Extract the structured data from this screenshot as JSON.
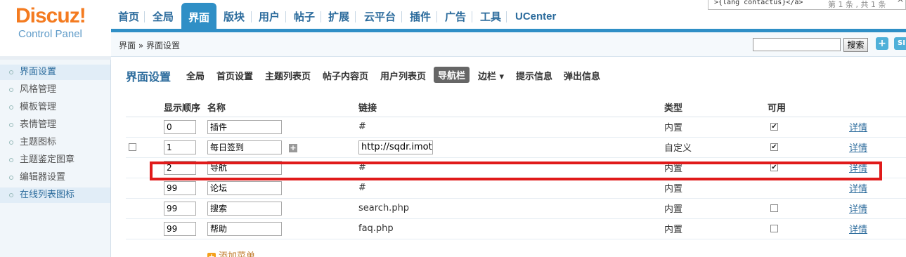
{
  "logo": {
    "brand": "Discuz!",
    "sub": "Control Panel"
  },
  "top_nav": [
    {
      "label": "首页"
    },
    {
      "label": "全局"
    },
    {
      "label": "界面"
    },
    {
      "label": "版块"
    },
    {
      "label": "用户"
    },
    {
      "label": "帖子"
    },
    {
      "label": "扩展"
    },
    {
      "label": "云平台"
    },
    {
      "label": "插件"
    },
    {
      "label": "广告"
    },
    {
      "label": "工具"
    },
    {
      "label": "UCenter"
    }
  ],
  "find_bar": {
    "query": ">{lang contactus}</a>",
    "result": "第 1 条 , 共 1 条"
  },
  "breadcrumb": "界面 » 界面设置",
  "search": {
    "value": "",
    "button": "搜索",
    "plus": "+",
    "si": "SI"
  },
  "sidebar": [
    {
      "label": "界面设置"
    },
    {
      "label": "风格管理"
    },
    {
      "label": "模板管理"
    },
    {
      "label": "表情管理"
    },
    {
      "label": "主题图标"
    },
    {
      "label": "主题鉴定图章"
    },
    {
      "label": "编辑器设置"
    },
    {
      "label": "在线列表图标"
    }
  ],
  "sub_nav": {
    "title": "界面设置",
    "tabs": [
      "全局",
      "首页设置",
      "主题列表页",
      "帖子内容页",
      "用户列表页",
      "导航栏",
      "边栏 ▾",
      "提示信息",
      "弹出信息"
    ]
  },
  "table": {
    "headers": [
      "显示顺序",
      "名称",
      "链接",
      "类型",
      "可用"
    ],
    "detail_label": "详情",
    "rows": [
      {
        "order": "0",
        "name": "插件",
        "link": "#",
        "link_is_input": false,
        "type": "内置",
        "enabled": true,
        "has_select": false,
        "has_add": false
      },
      {
        "order": "1",
        "name": "每日签到",
        "link": "http://sqdr.imot",
        "link_is_input": true,
        "type": "自定义",
        "enabled": true,
        "has_select": true,
        "has_add": true
      },
      {
        "order": "2",
        "name": "导航",
        "link": "#",
        "link_is_input": false,
        "type": "内置",
        "enabled": true,
        "has_select": false,
        "has_add": false
      },
      {
        "order": "99",
        "name": "论坛",
        "link": "#",
        "link_is_input": false,
        "type": "内置",
        "enabled": null,
        "has_select": false,
        "has_add": false
      },
      {
        "order": "99",
        "name": "搜索",
        "link": "search.php",
        "link_is_input": false,
        "type": "内置",
        "enabled": false,
        "has_select": false,
        "has_add": false
      },
      {
        "order": "99",
        "name": "帮助",
        "link": "faq.php",
        "link_is_input": false,
        "type": "内置",
        "enabled": false,
        "has_select": false,
        "has_add": false
      }
    ]
  },
  "add_menu": "添加菜单",
  "colors": {
    "accent": "#2f8fc6",
    "brand": "#f47b20",
    "highlight": "#e01a1a"
  }
}
